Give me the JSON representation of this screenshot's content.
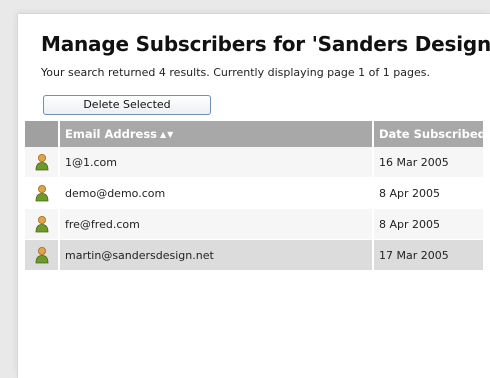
{
  "page": {
    "title": "Manage Subscribers for 'Sanders Design'",
    "summary": "Your search returned 4 results. Currently displaying page 1 of 1 pages.",
    "delete_label": "Delete Selected"
  },
  "table": {
    "headers": {
      "email": "Email Address",
      "email_sort": "▲▼",
      "date": "Date Subscribed"
    },
    "rows": [
      {
        "icon": "user-icon",
        "email": "1@1.com",
        "date": "16 Mar 2005"
      },
      {
        "icon": "user-icon",
        "email": "demo@demo.com",
        "date": "8 Apr 2005"
      },
      {
        "icon": "user-icon",
        "email": "fre@fred.com",
        "date": "8 Apr 2005"
      },
      {
        "icon": "user-icon",
        "email": "martin@sandersdesign.net",
        "date": "17 Mar 2005"
      }
    ]
  },
  "colors": {
    "header_bg": "#a8a8a8",
    "selected_row_bg": "#dcdcdc",
    "button_border": "#6d8fb8",
    "user_icon_body": "#6f9a2a",
    "user_icon_head": "#e0a34a"
  }
}
